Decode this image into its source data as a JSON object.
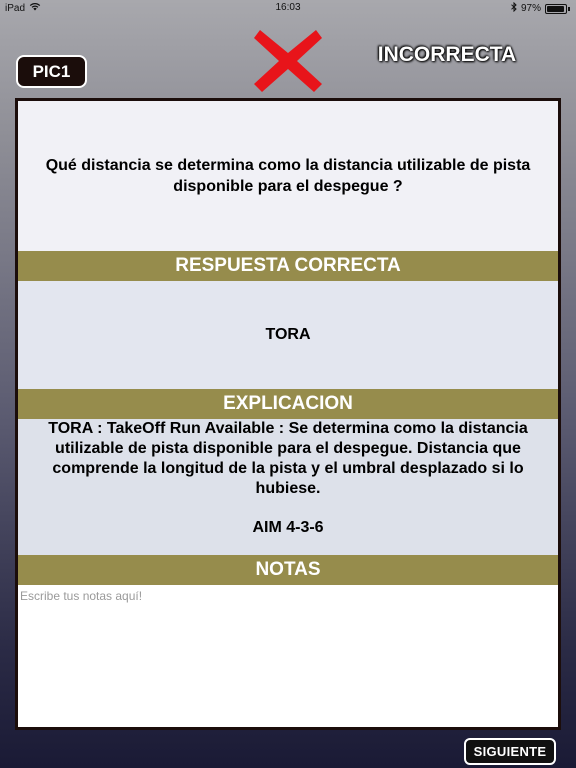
{
  "status_bar": {
    "device": "iPad",
    "time": "16:03",
    "battery": "97%",
    "battery_level": 0.97,
    "icons": [
      "wifi-icon",
      "bluetooth-icon",
      "battery-icon"
    ]
  },
  "header": {
    "tag_label": "PIC1",
    "result_icon": "red-x-icon",
    "result_label": "INCORRECTA"
  },
  "question": {
    "text": "Qué distancia se determina como la distancia utilizable de pista disponible para el despegue ?"
  },
  "correct_answer": {
    "header": "RESPUESTA CORRECTA",
    "text": "TORA"
  },
  "explanation": {
    "header": "EXPLICACION",
    "text": "TORA : TakeOff Run Available : Se determina como la distancia utilizable de pista disponible para el despegue. Distancia que comprende la longitud de la pista y el umbral desplazado si lo hubiese.",
    "reference": "AIM 4-3-6"
  },
  "notes": {
    "header": "NOTAS",
    "placeholder": "Escribe tus notas aquí!",
    "value": ""
  },
  "footer": {
    "next_label": "SIGUIENTE"
  },
  "colors": {
    "section_header": "#968c4c",
    "result_x": "#e8141a",
    "card_border": "#1b0d0b"
  }
}
